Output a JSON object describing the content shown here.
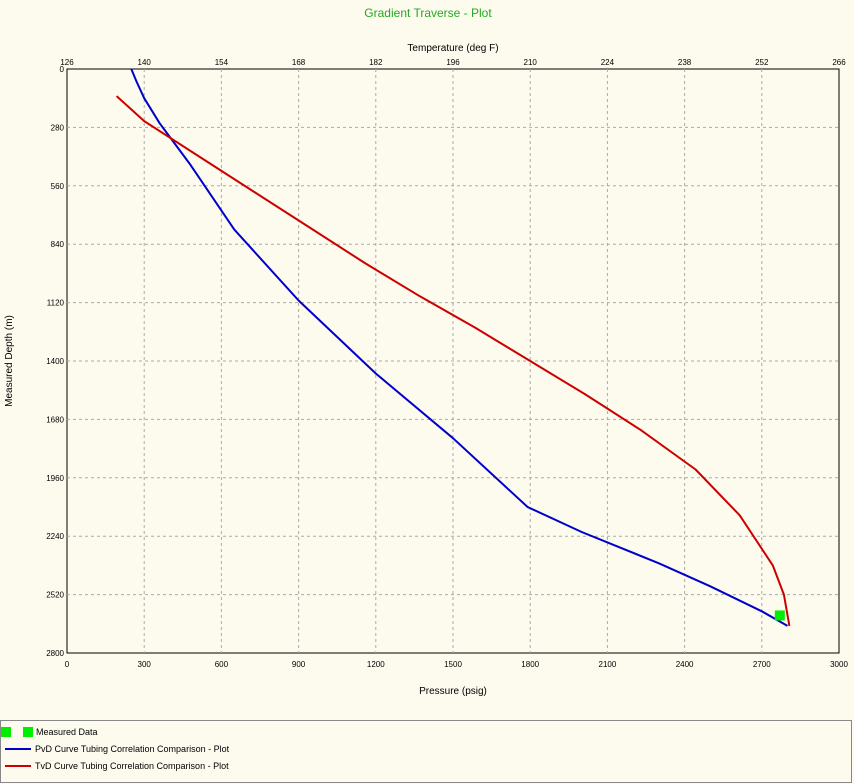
{
  "chart_data": {
    "type": "line",
    "title": "Gradient Traverse - Plot",
    "top_axis": {
      "label": "Temperature  (deg F)",
      "range": [
        126,
        266
      ],
      "ticks": [
        126,
        140,
        154,
        168,
        182,
        196,
        210,
        224,
        238,
        252,
        266
      ]
    },
    "bottom_axis": {
      "label": "Pressure  (psig)",
      "range": [
        0,
        3000
      ],
      "ticks": [
        0,
        300,
        600,
        900,
        1200,
        1500,
        1800,
        2100,
        2400,
        2700,
        3000
      ]
    },
    "y_axis": {
      "label": "Measured Depth  (m)",
      "range": [
        0,
        2800
      ],
      "inverted": true,
      "ticks": [
        0,
        280,
        560,
        840,
        1120,
        1400,
        1680,
        1960,
        2240,
        2520,
        2800
      ]
    },
    "grid": true,
    "series": [
      {
        "name": "PvD Curve Tubing Correlation Comparison - Plot",
        "color": "#0000cc",
        "axis": "pressure",
        "points": [
          [
            250,
            0
          ],
          [
            270,
            60
          ],
          [
            300,
            140
          ],
          [
            360,
            260
          ],
          [
            480,
            460
          ],
          [
            650,
            770
          ],
          [
            900,
            1110
          ],
          [
            1200,
            1460
          ],
          [
            1500,
            1770
          ],
          [
            1790,
            2100
          ],
          [
            2000,
            2220
          ],
          [
            2300,
            2370
          ],
          [
            2500,
            2480
          ],
          [
            2700,
            2600
          ],
          [
            2800,
            2670
          ]
        ]
      },
      {
        "name": "TvD Curve Tubing Correlation Comparison - Plot",
        "color": "#cc0000",
        "axis": "temperature",
        "points": [
          [
            135,
            130
          ],
          [
            140,
            250
          ],
          [
            150,
            420
          ],
          [
            160,
            590
          ],
          [
            170,
            760
          ],
          [
            180,
            930
          ],
          [
            190,
            1090
          ],
          [
            200,
            1240
          ],
          [
            210,
            1400
          ],
          [
            220,
            1560
          ],
          [
            230,
            1730
          ],
          [
            240,
            1920
          ],
          [
            248,
            2140
          ],
          [
            254,
            2380
          ],
          [
            256,
            2520
          ],
          [
            257,
            2670
          ]
        ]
      }
    ],
    "measured_data": {
      "name": "Measured Data",
      "color": "#00ee00",
      "points": [
        [
          2770,
          2620
        ]
      ]
    }
  }
}
